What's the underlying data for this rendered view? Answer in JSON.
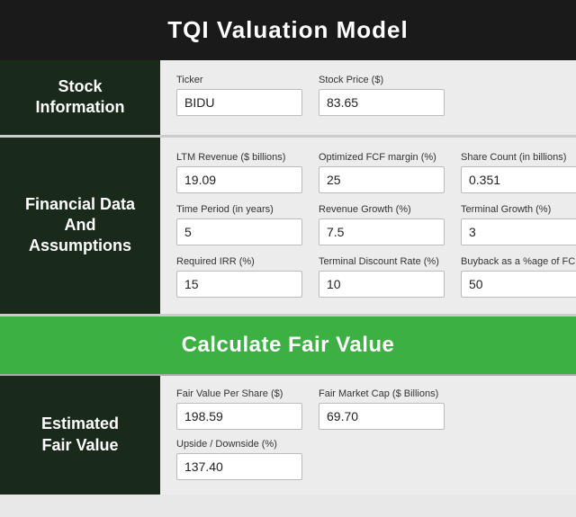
{
  "header": {
    "title": "TQI Valuation Model"
  },
  "stock_section": {
    "label": "Stock\nInformation",
    "fields": [
      {
        "id": "ticker",
        "label": "Ticker",
        "value": "BIDU"
      },
      {
        "id": "stock_price",
        "label": "Stock Price ($)",
        "value": "83.65"
      }
    ]
  },
  "financial_section": {
    "label": "Financial Data\nAnd\nAssumptions",
    "rows": [
      [
        {
          "id": "ltm_revenue",
          "label": "LTM Revenue ($ billions)",
          "value": "19.09"
        },
        {
          "id": "optimized_fcf",
          "label": "Optimized FCF margin (%)",
          "value": "25"
        },
        {
          "id": "share_count",
          "label": "Share Count (in billions)",
          "value": "0.351"
        }
      ],
      [
        {
          "id": "time_period",
          "label": "Time Period (in years)",
          "value": "5"
        },
        {
          "id": "revenue_growth",
          "label": "Revenue Growth (%)",
          "value": "7.5"
        },
        {
          "id": "terminal_growth",
          "label": "Terminal Growth (%)",
          "value": "3"
        }
      ],
      [
        {
          "id": "required_irr",
          "label": "Required IRR (%)",
          "value": "15"
        },
        {
          "id": "terminal_discount",
          "label": "Terminal Discount Rate (%)",
          "value": "10"
        },
        {
          "id": "buyback",
          "label": "Buyback as a %age of FCF",
          "value": "50"
        }
      ]
    ]
  },
  "calculate_button": {
    "label": "Calculate Fair Value"
  },
  "results_section": {
    "label": "Estimated\nFair Value",
    "fields": [
      {
        "id": "fair_value_per_share",
        "label": "Fair Value Per Share ($)",
        "value": "198.59"
      },
      {
        "id": "fair_market_cap",
        "label": "Fair Market Cap ($ Billions)",
        "value": "69.70"
      },
      {
        "id": "upside_downside",
        "label": "Upside / Downside (%)",
        "value": "137.40"
      }
    ]
  }
}
